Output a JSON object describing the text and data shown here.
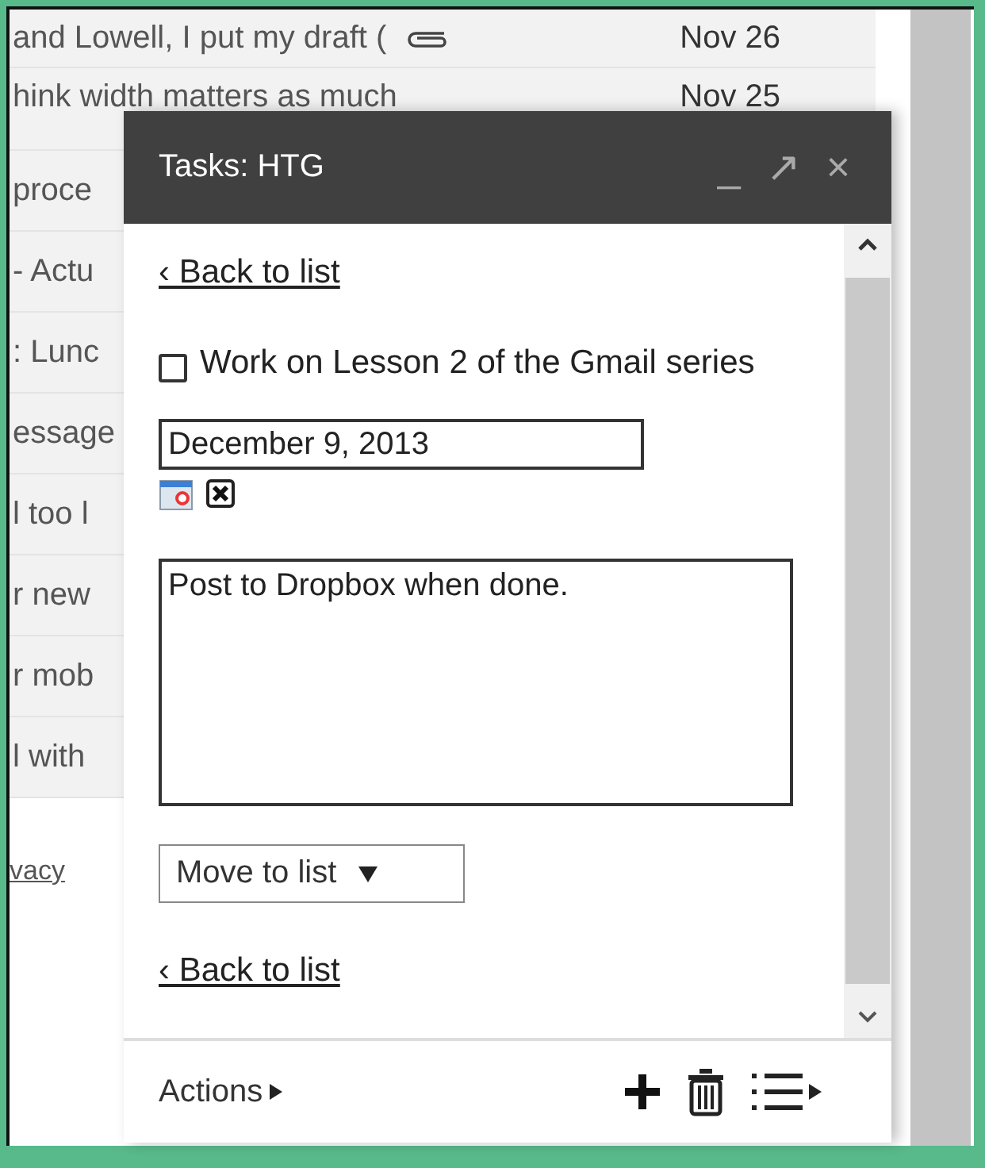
{
  "background_mail": {
    "rows": [
      {
        "text": "and Lowell, I put my draft (",
        "attachment": true,
        "date": "Nov 26"
      },
      {
        "text": "hink width matters as much",
        "date": "Nov 25"
      },
      {
        "text": "proce"
      },
      {
        "text": "- Actu"
      },
      {
        "text": ": Lunc"
      },
      {
        "text": "essage"
      },
      {
        "text": "l too l"
      },
      {
        "text": "r new"
      },
      {
        "text": "r mob"
      },
      {
        "text": "l with"
      }
    ],
    "footer_link": "vacy"
  },
  "tasks_window": {
    "title": "Tasks: HTG",
    "controls": [
      "_",
      "↗",
      "×"
    ],
    "back_link": "‹ Back to list",
    "task": {
      "title": "Work on Lesson 2 of the Gmail series",
      "checked": false
    },
    "due_date": "December 9, 2013",
    "notes": "Post to Dropbox when done.",
    "move_select": "Move to list",
    "back_link_bottom": "‹ Back to list",
    "actions": "Actions"
  }
}
